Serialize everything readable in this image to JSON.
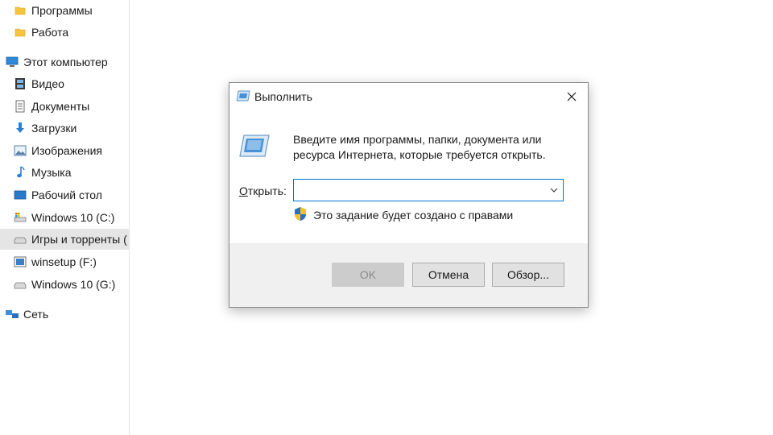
{
  "explorer_nav": {
    "items": [
      {
        "label": "Программы",
        "icon": "folder-icon"
      },
      {
        "label": "Работа",
        "icon": "folder-icon"
      },
      {
        "label": "Этот компьютер",
        "icon": "computer-icon"
      },
      {
        "label": "Видео",
        "icon": "video-icon"
      },
      {
        "label": "Документы",
        "icon": "documents-icon"
      },
      {
        "label": "Загрузки",
        "icon": "download-icon"
      },
      {
        "label": "Изображения",
        "icon": "pictures-icon"
      },
      {
        "label": "Музыка",
        "icon": "music-icon"
      },
      {
        "label": "Рабочий стол",
        "icon": "desktop-icon"
      },
      {
        "label": "Windows 10 (C:)",
        "icon": "system-drive-icon"
      },
      {
        "label": "Игры и торренты (",
        "icon": "drive-icon",
        "selected": true
      },
      {
        "label": "winsetup (F:)",
        "icon": "usb-drive-icon"
      },
      {
        "label": "Windows 10 (G:)",
        "icon": "drive-icon"
      },
      {
        "label": "Сеть",
        "icon": "network-icon"
      }
    ]
  },
  "run_dialog": {
    "title": "Выполнить",
    "description_line1": "Введите имя программы, папки, документа или",
    "description_line2": "ресурса Интернета, которые требуется открыть.",
    "open_label_prefix": "О",
    "open_label_rest": "ткрыть:",
    "open_value": "",
    "admin_note": "Это задание будет создано с правами",
    "buttons": {
      "ok": "OK",
      "cancel": "Отмена",
      "browse": "Обзор..."
    }
  },
  "colors": {
    "accent": "#0078d7",
    "selection": "#e5e5e5",
    "footer": "#f0f0f0"
  }
}
